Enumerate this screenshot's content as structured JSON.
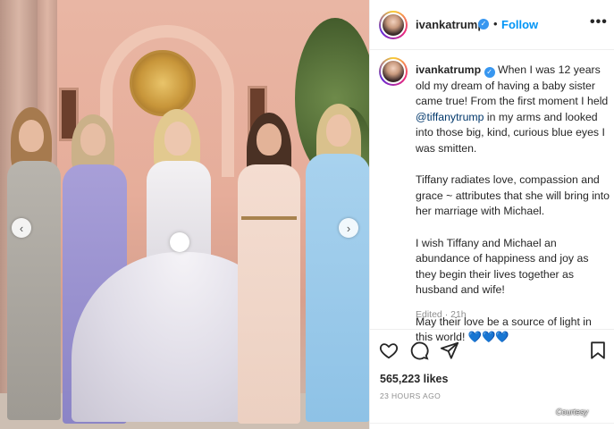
{
  "post": {
    "username": "ivankatrump",
    "follow_label": "Follow",
    "separator": "•",
    "more_label": "•••"
  },
  "caption": {
    "username": "ivankatrump",
    "p1_before": "When I was 12 years old my dream of having a baby sister came true! From the first moment I held ",
    "mention": "@tiffanytrump",
    "p1_after": " in my arms and looked into those big, kind, curious blue eyes I was smitten.",
    "p2": "Tiffany radiates love, compassion and grace ~ attributes that she will bring into her marriage with Michael.",
    "p3": "I wish Tiffany and Michael an abundance of happiness and joy as they begin their lives together as husband and wife!",
    "p4": "May their love be a source of light in this world!",
    "hearts": "💙💙💙",
    "edited": "Edited · 21h"
  },
  "engagement": {
    "likes": "565,223 likes",
    "timestamp": "23 HOURS AGO"
  },
  "photo": {
    "prev_arrow": "‹",
    "next_arrow": "›",
    "watermark": "Courtesy"
  },
  "icons": {
    "verified": "verified-badge-icon",
    "like": "heart-icon",
    "comment": "comment-icon",
    "share": "send-icon",
    "save": "bookmark-icon"
  },
  "colors": {
    "accent": "#0095f6",
    "mention": "#00376b",
    "verified": "#3897f0",
    "muted": "#8e8e8e"
  }
}
